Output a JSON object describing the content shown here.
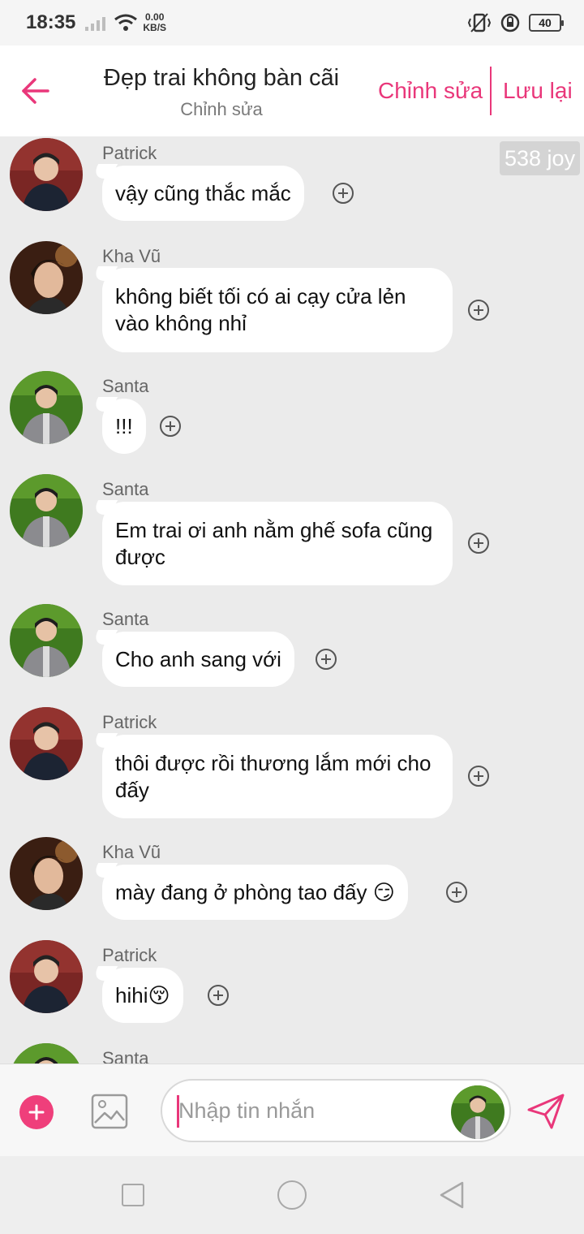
{
  "status_bar": {
    "time": "18:35",
    "speed_value": "0.00",
    "speed_unit": "KB/S",
    "battery": "40"
  },
  "header": {
    "title": "Đẹp trai không bàn cãi",
    "subtitle": "Chỉnh sửa",
    "edit_label": "Chỉnh sửa",
    "save_label": "Lưu lại",
    "back_icon": "arrow-left-icon"
  },
  "chat": {
    "joy_badge": "538 joy",
    "messages": [
      {
        "sender": "Patrick",
        "avatar": "patrick",
        "text": "vậy cũng thắc mắc"
      },
      {
        "sender": "Kha Vũ",
        "avatar": "khavu",
        "text": "không biết tối có ai cạy cửa lẻn vào không nhỉ"
      },
      {
        "sender": "Santa",
        "avatar": "santa",
        "text": "!!!"
      },
      {
        "sender": "Santa",
        "avatar": "santa",
        "text": "Em trai ơi anh nằm ghế sofa cũng được"
      },
      {
        "sender": "Santa",
        "avatar": "santa",
        "text": "Cho anh sang với"
      },
      {
        "sender": "Patrick",
        "avatar": "patrick",
        "text": "thôi được rồi thương lắm mới cho đấy"
      },
      {
        "sender": "Kha Vũ",
        "avatar": "khavu",
        "text": "mày đang ở phòng tao đấy 😏"
      },
      {
        "sender": "Patrick",
        "avatar": "patrick",
        "text": "hihi😚"
      },
      {
        "sender": "Santa",
        "avatar": "santa",
        "text": ""
      }
    ]
  },
  "input": {
    "placeholder": "Nhập tin nhắn",
    "add_icon": "plus-circle-icon",
    "image_icon": "image-icon",
    "send_icon": "send-icon"
  },
  "colors": {
    "accent": "#e9377a",
    "background": "#ebebeb",
    "bubble": "#ffffff"
  }
}
